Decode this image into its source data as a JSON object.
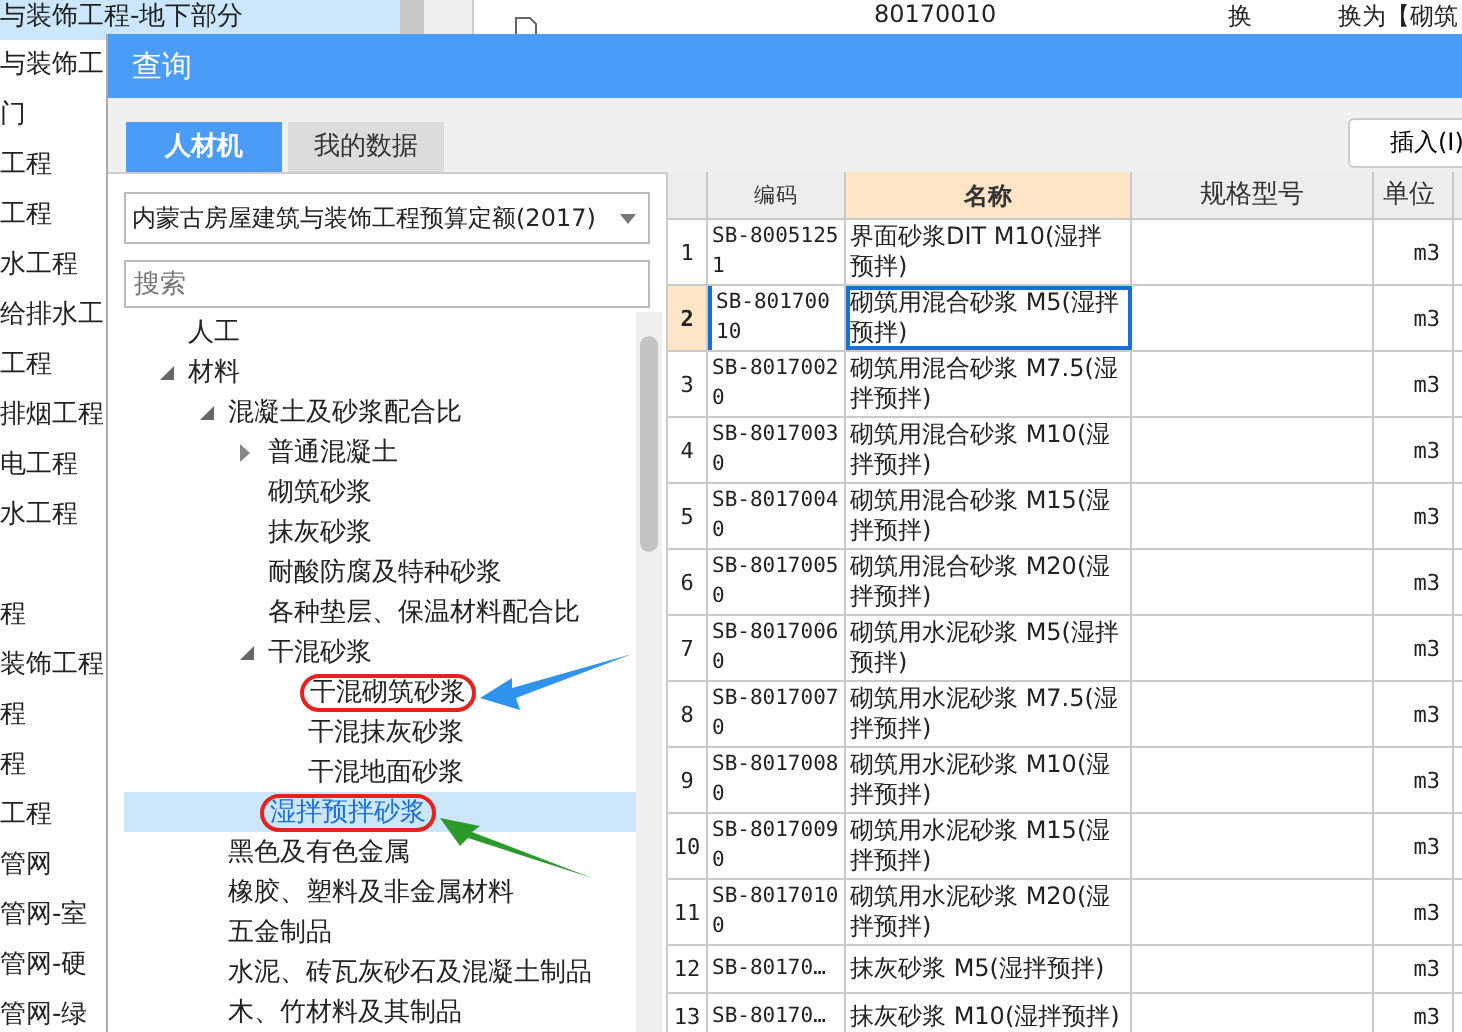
{
  "background": {
    "list": [
      {
        "label": "与装饰工程-地下部分",
        "selected": true
      },
      {
        "label": "与装饰工",
        "selected": false
      },
      {
        "label": "门",
        "selected": false
      },
      {
        "label": "工程",
        "selected": false
      },
      {
        "label": "工程",
        "selected": false
      },
      {
        "label": "水工程",
        "selected": false
      },
      {
        "label": "给排水工",
        "selected": false
      },
      {
        "label": "工程",
        "selected": false
      },
      {
        "label": "排烟工程",
        "selected": false
      },
      {
        "label": "电工程",
        "selected": false
      },
      {
        "label": "水工程",
        "selected": false
      },
      {
        "selected": false
      },
      {
        "label": "程",
        "selected": false
      },
      {
        "label": "装饰工程",
        "selected": false
      },
      {
        "label": "程",
        "selected": false
      },
      {
        "label": "程",
        "selected": false
      },
      {
        "label": "工程",
        "selected": false
      },
      {
        "label": "管网",
        "selected": false
      },
      {
        "label": "管网-室",
        "selected": false
      },
      {
        "label": "管网-硬",
        "selected": false
      },
      {
        "label": "管网-绿",
        "selected": false
      }
    ],
    "top_grid": {
      "code": "80170010",
      "flag": "换",
      "note": "换为【砌筑"
    }
  },
  "dialog": {
    "title": "查询",
    "tabs": [
      {
        "label": "人材机",
        "selected": true
      },
      {
        "label": "我的数据",
        "selected": false
      }
    ],
    "insert_button": "插入(I)",
    "library": "内蒙古房屋建筑与装饰工程预算定额(2017)",
    "search": {
      "placeholder": "搜索"
    },
    "tree": [
      {
        "label": "人工",
        "expanded": false,
        "selected": false,
        "circled": false
      },
      {
        "label": "材料",
        "expanded": true,
        "selected": false,
        "circled": false,
        "children": [
          {
            "label": "混凝土及砂浆配合比",
            "expanded": true,
            "selected": false,
            "circled": false,
            "children": [
              {
                "label": "普通混凝土",
                "expanded": false,
                "has_children": true,
                "selected": false,
                "circled": false
              },
              {
                "label": "砌筑砂浆",
                "expanded": false,
                "selected": false,
                "circled": false
              },
              {
                "label": "抹灰砂浆",
                "expanded": false,
                "selected": false,
                "circled": false
              },
              {
                "label": "耐酸防腐及特种砂浆",
                "expanded": false,
                "selected": false,
                "circled": false
              },
              {
                "label": "各种垫层、保温材料配合比",
                "expanded": false,
                "selected": false,
                "circled": false
              },
              {
                "label": "干混砂浆",
                "expanded": true,
                "selected": false,
                "circled": false,
                "children": [
                  {
                    "label": "干混砌筑砂浆",
                    "expanded": false,
                    "selected": false,
                    "circled": true,
                    "color": "#2f93ee"
                  },
                  {
                    "label": "干混抹灰砂浆",
                    "expanded": false,
                    "selected": false,
                    "circled": false
                  },
                  {
                    "label": "干混地面砂浆",
                    "expanded": false,
                    "selected": false,
                    "circled": false
                  }
                ]
              },
              {
                "label": "湿拌预拌砂浆",
                "expanded": false,
                "selected": true,
                "circled": true,
                "color": "#2a9b2a"
              }
            ]
          },
          {
            "label": "黑色及有色金属",
            "expanded": false,
            "selected": false,
            "circled": false
          },
          {
            "label": "橡胶、塑料及非金属材料",
            "expanded": false,
            "selected": false,
            "circled": false
          },
          {
            "label": "五金制品",
            "expanded": false,
            "selected": false,
            "circled": false
          },
          {
            "label": "水泥、砖瓦灰砂石及混凝土制品",
            "expanded": false,
            "selected": false,
            "circled": false
          },
          {
            "label": "木、竹材料及其制品",
            "expanded": false,
            "selected": false,
            "circled": false
          }
        ]
      }
    ],
    "table": {
      "columns": [
        {
          "label": "编码",
          "sorted": false
        },
        {
          "label": "名称",
          "sorted": true
        },
        {
          "label": "规格型号",
          "sorted": false
        },
        {
          "label": "单位",
          "sorted": false
        }
      ],
      "rows": [
        {
          "num": "1",
          "code": "SB-80051251",
          "name": "界面砂浆DIT M10(湿拌预拌)",
          "unit": "m3",
          "selected": false
        },
        {
          "num": "2",
          "code": "SB-80170010",
          "name": "砌筑用混合砂浆 M5(湿拌预拌)",
          "unit": "m3",
          "selected": true
        },
        {
          "num": "3",
          "code": "SB-80170020",
          "name": "砌筑用混合砂浆 M7.5(湿拌预拌)",
          "unit": "m3",
          "selected": false
        },
        {
          "num": "4",
          "code": "SB-80170030",
          "name": "砌筑用混合砂浆 M10(湿拌预拌)",
          "unit": "m3",
          "selected": false
        },
        {
          "num": "5",
          "code": "SB-80170040",
          "name": "砌筑用混合砂浆 M15(湿拌预拌)",
          "unit": "m3",
          "selected": false
        },
        {
          "num": "6",
          "code": "SB-80170050",
          "name": "砌筑用混合砂浆 M20(湿拌预拌)",
          "unit": "m3",
          "selected": false
        },
        {
          "num": "7",
          "code": "SB-80170060",
          "name": "砌筑用水泥砂浆 M5(湿拌预拌)",
          "unit": "m3",
          "selected": false
        },
        {
          "num": "8",
          "code": "SB-80170070",
          "name": "砌筑用水泥砂浆 M7.5(湿拌预拌)",
          "unit": "m3",
          "selected": false
        },
        {
          "num": "9",
          "code": "SB-80170080",
          "name": "砌筑用水泥砂浆 M10(湿拌预拌)",
          "unit": "m3",
          "selected": false
        },
        {
          "num": "10",
          "code": "SB-80170090",
          "name": "砌筑用水泥砂浆 M15(湿拌预拌)",
          "unit": "m3",
          "selected": false
        },
        {
          "num": "11",
          "code": "SB-80170100",
          "name": "砌筑用水泥砂浆 M20(湿拌预拌)",
          "unit": "m3",
          "selected": false
        },
        {
          "num": "12",
          "code": "SB-80170…",
          "name": "抹灰砂浆 M5(湿拌预拌)",
          "unit": "m3",
          "selected": false
        },
        {
          "num": "13",
          "code": "SB-80170…",
          "name": "抹灰砂浆 M10(湿拌预拌)",
          "unit": "m3",
          "selected": false
        }
      ]
    }
  }
}
